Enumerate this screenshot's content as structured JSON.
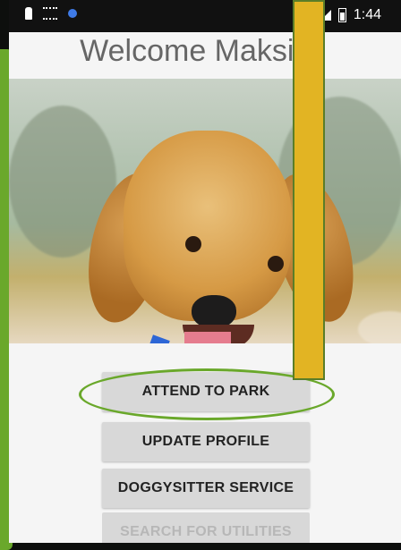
{
  "status_bar": {
    "time": "1:44",
    "icons": [
      "person-icon",
      "dots-icon",
      "notification-bubble-icon",
      "signal-icon",
      "battery-icon"
    ]
  },
  "header": {
    "welcome_text": "Welcome Maksi  L"
  },
  "hero": {
    "image_subject": "puppy"
  },
  "buttons": {
    "attend_park": "ATTEND TO PARK",
    "update_profile": "UPDATE PROFILE",
    "doggysitter": "DOGGYSITTER SERVICE",
    "search_utilities": "SEARCH FOR UTILITIES"
  },
  "colors": {
    "highlight_green": "#6aa82b",
    "overlay_gold": "#e2b423",
    "button_bg": "#d8d8d8"
  }
}
